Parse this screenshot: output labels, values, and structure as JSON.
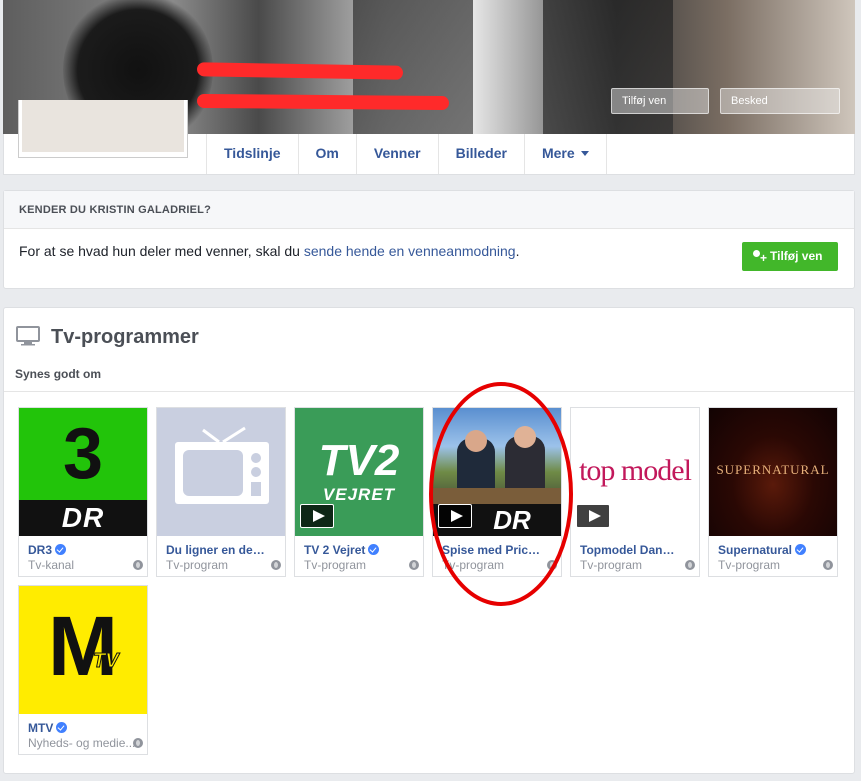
{
  "cover": {
    "buttons": [
      "Tilføj ven",
      "Besked"
    ]
  },
  "nav": {
    "tabs": [
      "Tidslinje",
      "Om",
      "Venner",
      "Billeder",
      "Mere"
    ]
  },
  "friend_card": {
    "heading": "KENDER DU KRISTIN GALADRIEL?",
    "text_before": "For at se hvad hun deler med venner, skal du ",
    "link": "sende hende en venneanmodning",
    "text_after": ".",
    "button": "Tilføj ven"
  },
  "tv_section": {
    "title": "Tv-programmer",
    "subtitle": "Synes godt om",
    "items": [
      {
        "name": "DR3",
        "category": "Tv-kanal",
        "verified": true,
        "video": false
      },
      {
        "name": "Du ligner en der t...",
        "category": "Tv-program",
        "verified": false,
        "video": false
      },
      {
        "name": "TV 2 Vejret",
        "category": "Tv-program",
        "verified": true,
        "video": true
      },
      {
        "name": "Spise med Price ...",
        "category": "Tv-program",
        "verified": false,
        "video": true
      },
      {
        "name": "Topmodel Danm...",
        "category": "Tv-program",
        "verified": false,
        "video": true
      },
      {
        "name": "Supernatural",
        "category": "Tv-program",
        "verified": true,
        "video": false
      },
      {
        "name": "MTV",
        "category": "Nyheds- og medie...",
        "verified": true,
        "video": false
      }
    ],
    "thumb_text": {
      "dr3_number": "3",
      "dr3_brand": "DR",
      "tv2_logo": "TV2",
      "tv2_sub": "VEJRET",
      "price_brand": "DR",
      "topmodel": "top model",
      "supernatural": "SUPERNATURAL",
      "mtv_letter": "M",
      "mtv_sub": "TV"
    }
  },
  "colors": {
    "link": "#365899",
    "add_button": "#42b72a",
    "dr3_green": "#22c40a",
    "tv2_green": "#3a9c58",
    "mtv_yellow": "#ffec00",
    "highlight": "#e60000"
  }
}
